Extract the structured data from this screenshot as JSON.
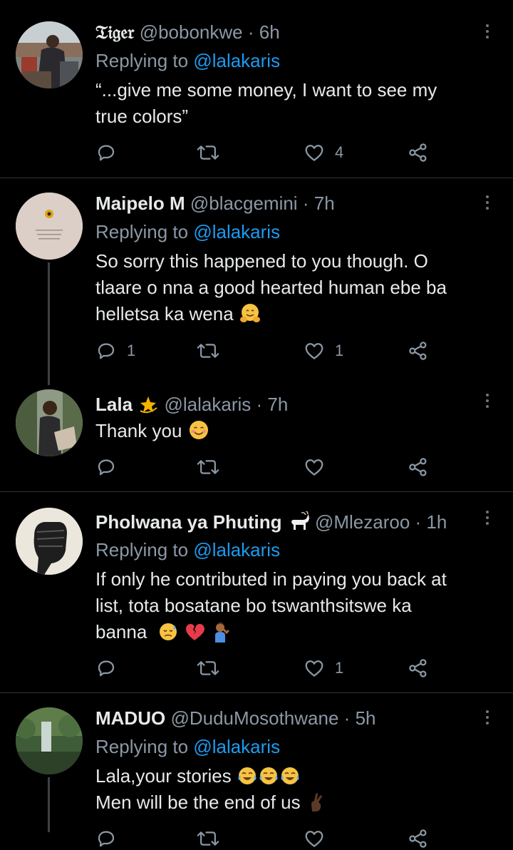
{
  "tweets": [
    {
      "name": "𝔗𝔦𝔤𝔢𝔯",
      "handle": "@bobonkwe",
      "sep": "·",
      "time": "6h",
      "reply_prefix": "Replying to ",
      "reply_to": "@lalakaris",
      "lines": [
        "“...give me some money, I want to see my",
        "true colors”"
      ],
      "reply_count": "",
      "retweet_count": "",
      "like_count": "4"
    },
    {
      "name": "Maipelo M",
      "handle": "@blacgemini",
      "sep": "·",
      "time": "7h",
      "reply_prefix": "Replying to ",
      "reply_to": "@lalakaris",
      "lines": [
        "So sorry this happened to you though. O",
        "tlaare o nna a good hearted human ebe ba",
        "helletsa ka wena"
      ],
      "reply_count": "1",
      "retweet_count": "",
      "like_count": "1"
    },
    {
      "name": "Lala",
      "handle": "@lalakaris",
      "sep": "·",
      "time": "7h",
      "lines": [
        "Thank you"
      ],
      "reply_count": "",
      "retweet_count": "",
      "like_count": ""
    },
    {
      "name": "Pholwana ya Phuting",
      "handle": "@Mlezaroo",
      "sep": "·",
      "time": "1h",
      "reply_prefix": "Replying to ",
      "reply_to": "@lalakaris",
      "lines": [
        "If only he contributed in paying you back at",
        "list, tota bosatane bo tswanthsitswe ka",
        "banna"
      ],
      "reply_count": "",
      "retweet_count": "",
      "like_count": "1"
    },
    {
      "name": "MADUO",
      "handle": "@DuduMosothwane",
      "sep": "·",
      "time": "5h",
      "reply_prefix": "Replying to ",
      "reply_to": "@lalakaris",
      "lines": [
        "Lala,your stories",
        "Men will be the end of us"
      ],
      "reply_count": "",
      "retweet_count": "",
      "like_count": ""
    }
  ],
  "icons": {
    "reply": "reply-icon",
    "retweet": "retweet-icon",
    "like": "heart-icon",
    "share": "share-icon",
    "more": "more-options-icon"
  },
  "colors": {
    "background": "#000000",
    "text": "#e7e9ea",
    "muted": "#8b98a5",
    "link": "#1d9bf0",
    "divider": "#2f3336"
  }
}
